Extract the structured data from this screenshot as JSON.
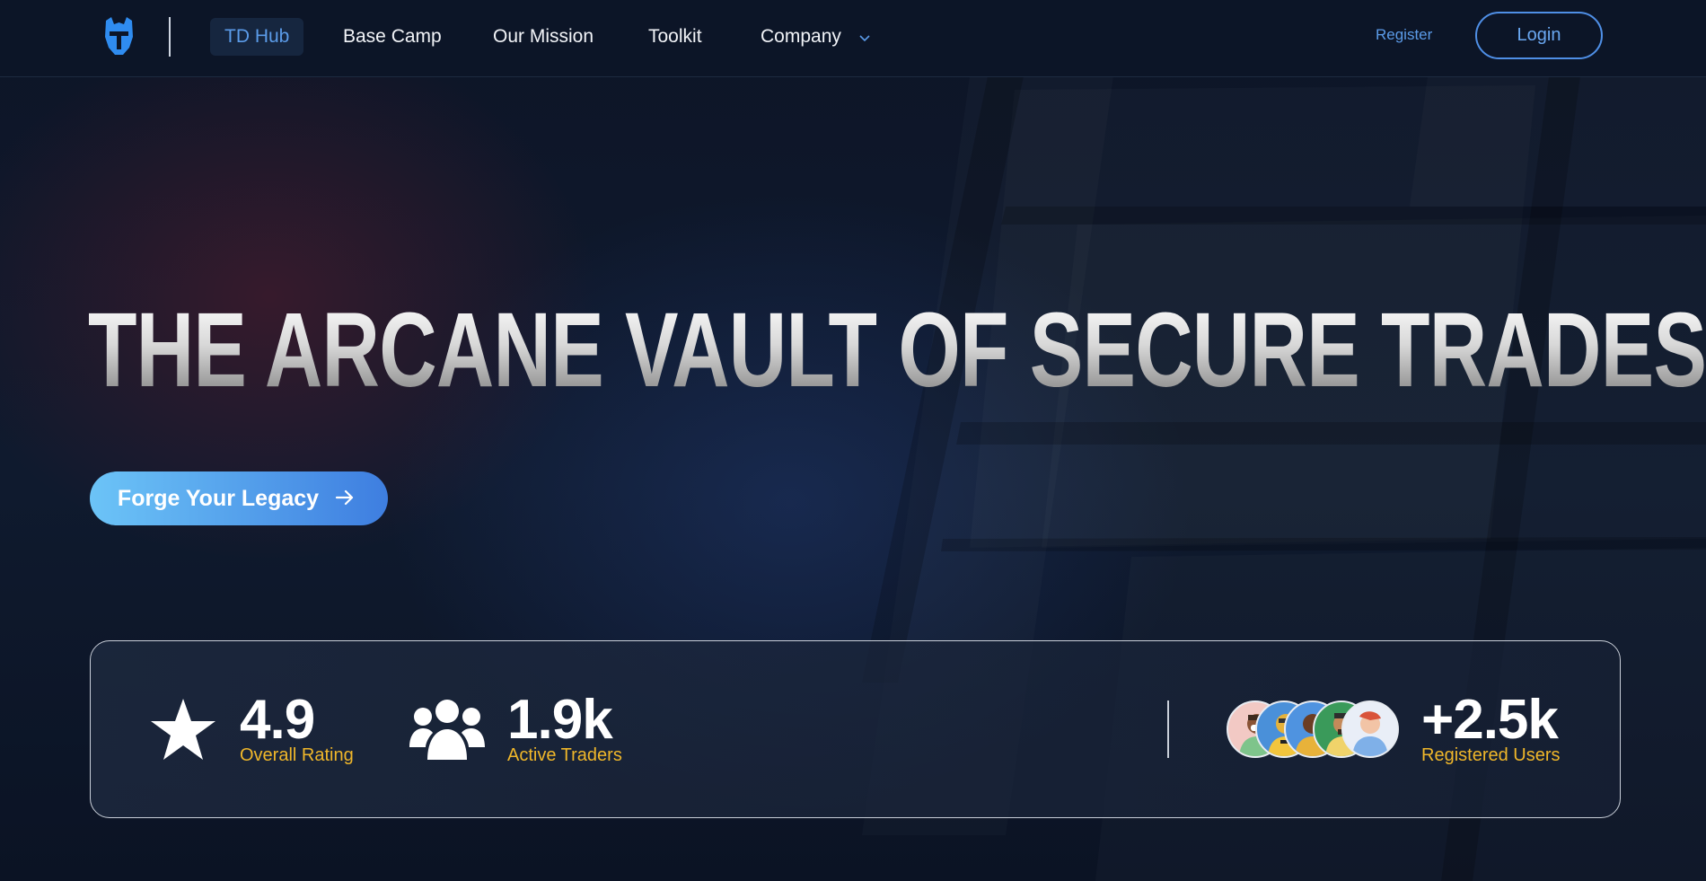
{
  "nav": {
    "logo_icon": "knight-helmet-icon",
    "items": [
      {
        "label": "TD Hub",
        "active": true
      },
      {
        "label": "Base Camp",
        "active": false
      },
      {
        "label": "Our Mission",
        "active": false
      },
      {
        "label": "Toolkit",
        "active": false
      },
      {
        "label": "Company",
        "active": false,
        "dropdown": true
      }
    ],
    "register_label": "Register",
    "login_label": "Login"
  },
  "hero": {
    "title": "THE ARCANE VAULT OF SECURE TRADES",
    "cta_label": "Forge Your Legacy",
    "cta_icon": "arrow-right-icon"
  },
  "stats": {
    "rating": {
      "icon": "star-icon",
      "value": "4.9",
      "label": "Overall Rating"
    },
    "traders": {
      "icon": "users-group-icon",
      "value": "1.9k",
      "label": "Active Traders"
    },
    "users": {
      "value": "+2.5k",
      "label": "Registered Users",
      "avatar_count": 5
    }
  },
  "colors": {
    "accent": "#5b9be8",
    "highlight": "#f0b72a",
    "background": "#0b1222",
    "cta_start": "#6cc4f7",
    "cta_end": "#3e7ee0"
  }
}
